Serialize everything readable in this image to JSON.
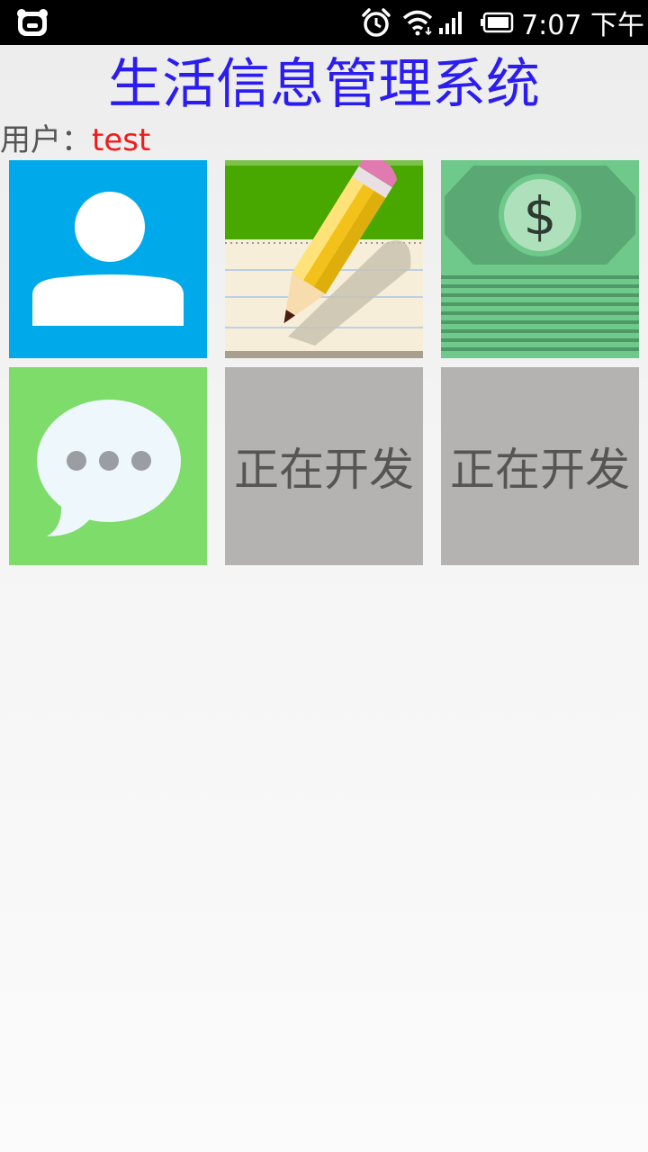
{
  "status_bar": {
    "left_icon": "bear-face-icon",
    "icons": [
      "alarm-clock-icon",
      "wifi-icon",
      "signal-bars-icon",
      "battery-icon"
    ],
    "time": "7:07 下午"
  },
  "header": {
    "title": "生活信息管理系统"
  },
  "user": {
    "label": "用户：",
    "name": "test"
  },
  "tiles": [
    {
      "name": "contacts-tile",
      "icon": "person-icon",
      "color": "#00a9ea"
    },
    {
      "name": "notes-tile",
      "icon": "pencil-notepad-icon",
      "color": "#48a800"
    },
    {
      "name": "finance-tile",
      "icon": "dollar-bill-icon",
      "color": "#6ec98a"
    },
    {
      "name": "messages-tile",
      "icon": "chat-bubble-icon",
      "color": "#7ddc6a"
    },
    {
      "name": "dev-tile-1",
      "label": "正在开发",
      "color": "#b4b3b2"
    },
    {
      "name": "dev-tile-2",
      "label": "正在开发",
      "color": "#b4b3b2"
    }
  ]
}
